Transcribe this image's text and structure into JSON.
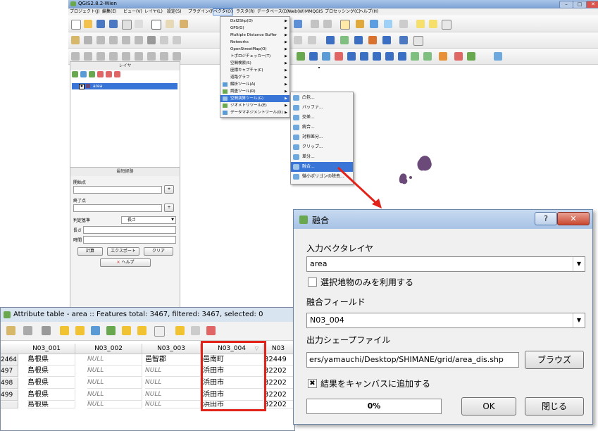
{
  "qgis": {
    "title": "QGIS2.8.2-Wien",
    "menu": [
      "プロジェクト(J)",
      "編集(E)",
      "ビュー(V)",
      "レイヤ(L)",
      "設定(S)",
      "プラグイン(P)",
      "ベクタ(O)",
      "ラスタ(R)",
      "データベース(D)",
      "Web(W)",
      "MMQGIS",
      "プロセッシング(C)",
      "ヘルプ(H)"
    ],
    "layers_title": "レイヤ",
    "layer_name": "area",
    "route_title": "最短経路",
    "start_label": "開始点",
    "end_label": "終了点",
    "criterion_label": "判定基準",
    "criterion_value": "長さ",
    "length_label": "長さ",
    "time_label": "時間",
    "calc_button": "計算",
    "export_button": "エクスポート",
    "clear_button": "クリア",
    "help_button": "ヘルプ",
    "plus": "+"
  },
  "vector_menu": {
    "items": [
      "Dxf2Shp(D)",
      "GPS(G)",
      "Multiple Distance Buffer",
      "Networks",
      "OpenStreetMap(O)",
      "トポロジチェッカー(T)",
      "空間検索(S)",
      "座標キャプチャ(C)",
      "道路グラフ",
      "解析ツール(A)",
      "調査ツール(R)",
      "空間演算ツール(G)",
      "ジオメトリツール(E)",
      "データマネジメントツール(D)"
    ],
    "highlighted": "空間演算ツール(G)"
  },
  "geo_menu": {
    "items": [
      "凸包...",
      "バッファ...",
      "交差...",
      "統合...",
      "対称差分...",
      "クリップ...",
      "差分...",
      "融合...",
      "微小ポリゴンの除去..."
    ],
    "highlighted": "融合..."
  },
  "attribute_table": {
    "title": "Attribute table - area :: Features total: 3467, filtered: 3467, selected: 0",
    "columns": [
      "N03_001",
      "N03_002",
      "N03_003",
      "N03_004",
      "N03"
    ],
    "rows": [
      {
        "id": "2464",
        "c1": "島根県",
        "c2": "NULL",
        "c3": "邑智郡",
        "c4": "邑南町",
        "c5": "32449"
      },
      {
        "id": "497",
        "c1": "島根県",
        "c2": "NULL",
        "c3": "NULL",
        "c4": "浜田市",
        "c5": "32202"
      },
      {
        "id": "498",
        "c1": "島根県",
        "c2": "NULL",
        "c3": "NULL",
        "c4": "浜田市",
        "c5": "32202"
      },
      {
        "id": "499",
        "c1": "島根県",
        "c2": "NULL",
        "c3": "NULL",
        "c4": "浜田市",
        "c5": "32202"
      },
      {
        "id": "",
        "c1": "島根県",
        "c2": "NULL",
        "c3": "NULL",
        "c4": "浜田市",
        "c5": "32202"
      }
    ]
  },
  "dissolve_dialog": {
    "title": "融合",
    "help": "?",
    "close": "✕",
    "input_label": "入力ベクタレイヤ",
    "input_value": "area",
    "selected_only_label": "選択地物のみを利用する",
    "selected_only_checked": false,
    "field_label": "融合フィールド",
    "field_value": "N03_004",
    "output_label": "出力シェープファイル",
    "output_value": "ers/yamauchi/Desktop/SHIMANE/grid/area_dis.shp",
    "browse_button": "ブラウズ",
    "add_to_canvas_label": "結果をキャンバスに追加する",
    "add_to_canvas_checked": true,
    "progress_text": "0%",
    "progress": 0,
    "ok_button": "OK",
    "close_button": "閉じる"
  },
  "colors": {
    "accent": "#3875d7",
    "highlight_box": "#e2231a",
    "map_feature": "#6b4a7a"
  }
}
